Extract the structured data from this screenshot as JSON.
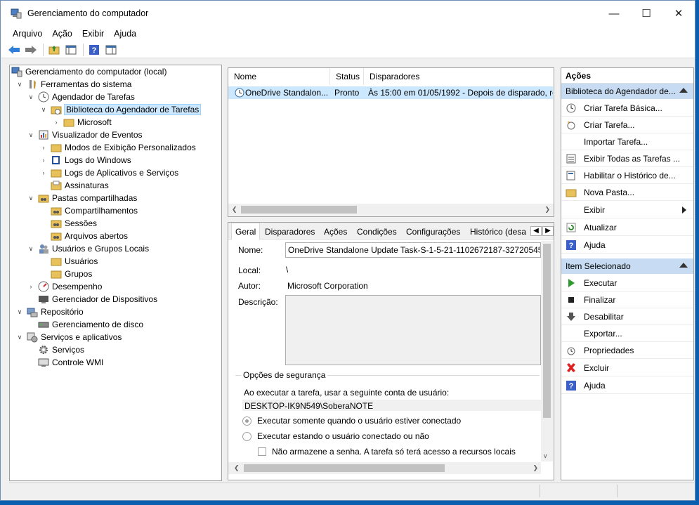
{
  "window": {
    "title": "Gerenciamento do computador"
  },
  "menu": [
    "Arquivo",
    "Ação",
    "Exibir",
    "Ajuda"
  ],
  "tree": {
    "root": "Gerenciamento do computador (local)",
    "items": [
      "Ferramentas do sistema",
      "Agendador de Tarefas",
      "Biblioteca do Agendador de Tarefas",
      "Microsoft",
      "Visualizador de Eventos",
      "Modos de Exibição Personalizados",
      "Logs do Windows",
      "Logs de Aplicativos e Serviços",
      "Assinaturas",
      "Pastas compartilhadas",
      "Compartilhamentos",
      "Sessões",
      "Arquivos abertos",
      "Usuários e Grupos Locais",
      "Usuários",
      "Grupos",
      "Desempenho",
      "Gerenciador de Dispositivos",
      "Repositório",
      "Gerenciamento de disco",
      "Serviços e aplicativos",
      "Serviços",
      "Controle WMI"
    ]
  },
  "tasks": {
    "columns": [
      "Nome",
      "Status",
      "Disparadores"
    ],
    "rows": [
      {
        "name": "OneDrive Standalon...",
        "status": "Pronto",
        "trigger": "Às 15:00 em 01/05/1992 - Depois de disparado, rep"
      }
    ]
  },
  "details": {
    "tabs": [
      "Geral",
      "Disparadores",
      "Ações",
      "Condições",
      "Configurações",
      "Histórico (desa"
    ],
    "name_label": "Nome:",
    "name_value": "OneDrive Standalone Update Task-S-1-5-21-1102672187-3272054596-",
    "location_label": "Local:",
    "location_value": "\\",
    "author_label": "Autor:",
    "author_value": "Microsoft Corporation",
    "description_label": "Descrição:",
    "security_legend": "Opções de segurança",
    "run_as_label": "Ao executar a tarefa, usar a seguinte conta de usuário:",
    "run_as_account": "DESKTOP-IK9N549\\SoberaNOTE",
    "opt_logged_on": "Executar somente quando o usuário estiver conectado",
    "opt_any": "Executar estando o usuário conectado ou não",
    "opt_no_password": "Não armazene a senha. A tarefa só terá acesso a recursos locais"
  },
  "actions": {
    "title": "Ações",
    "group1": "Biblioteca do Agendador de...",
    "group1_items": [
      "Criar Tarefa Básica...",
      "Criar Tarefa...",
      "Importar Tarefa...",
      "Exibir Todas as Tarefas ...",
      "Habilitar o Histórico de...",
      "Nova Pasta...",
      "Exibir",
      "Atualizar",
      "Ajuda"
    ],
    "group2": "Item Selecionado",
    "group2_items": [
      "Executar",
      "Finalizar",
      "Desabilitar",
      "Exportar...",
      "Propriedades",
      "Excluir",
      "Ajuda"
    ]
  }
}
